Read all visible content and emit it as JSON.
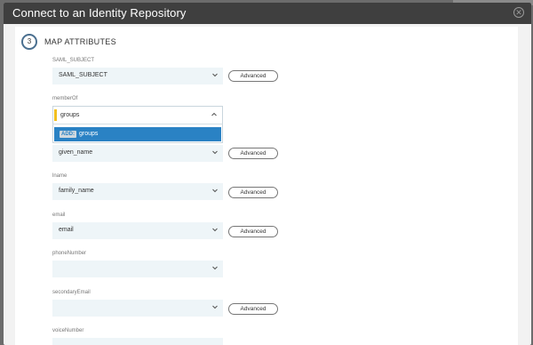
{
  "window": {
    "title": "Connect to an Identity Repository",
    "close_icon": "close-icon"
  },
  "step": {
    "number": "3",
    "title": "MAP ATTRIBUTES"
  },
  "advanced_label": "Advanced",
  "fields": {
    "saml_subject": {
      "label": "SAML_SUBJECT",
      "value": "SAML_SUBJECT"
    },
    "member_of": {
      "label": "memberOf",
      "input_value": "groups"
    },
    "dropdown": {
      "tag": "ADD:",
      "text": "groups"
    },
    "given_name": {
      "value": "given_name"
    },
    "lname": {
      "label": "lname",
      "value": "family_name"
    },
    "email": {
      "label": "email",
      "value": "email"
    },
    "phone_number": {
      "label": "phoneNumber",
      "value": ""
    },
    "secondary_email": {
      "label": "secondaryEmail",
      "value": ""
    },
    "voice_number": {
      "label": "voiceNumber"
    }
  },
  "colors": {
    "title_bar": "#3f3f3f",
    "select_bg": "#eef5f8",
    "dropdown_highlight": "#2a82c4",
    "accent": "#f1bf1f"
  }
}
